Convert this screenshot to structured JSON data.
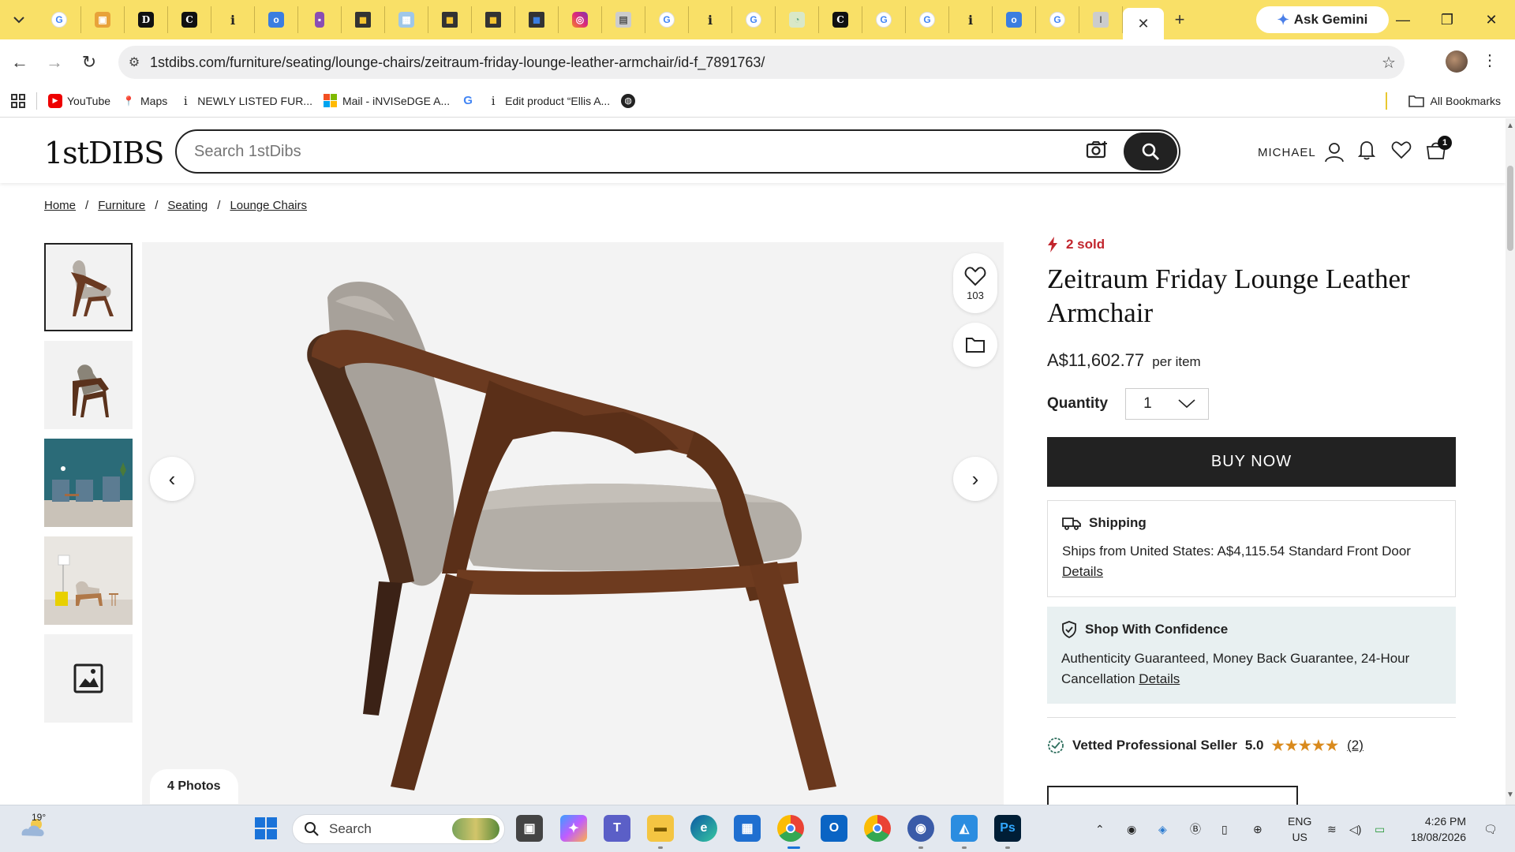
{
  "browser": {
    "active_tab_close": "✕",
    "new_tab": "+",
    "ask_gemini": "Ask Gemini",
    "url": "1stdibs.com/furniture/seating/lounge-chairs/zeitraum-friday-lounge-leather-armchair/id-f_7891763/",
    "bookmarks": [
      {
        "label": "YouTube",
        "icon": "youtube-icon"
      },
      {
        "label": "Maps",
        "icon": "maps-icon"
      },
      {
        "label": "NEWLY LISTED FUR...",
        "icon": "info-icon"
      },
      {
        "label": "Mail - iNVISeDGE A...",
        "icon": "microsoft-icon"
      },
      {
        "label": "",
        "icon": "google-icon"
      },
      {
        "label": "Edit product “Ellis A...",
        "icon": "info-icon"
      },
      {
        "label": "",
        "icon": "globe-icon"
      }
    ],
    "all_bookmarks": "All Bookmarks"
  },
  "site": {
    "logo": "1stDIBS",
    "search_placeholder": "Search 1stDibs",
    "user_name": "MICHAEL",
    "cart_count": "1"
  },
  "breadcrumb": [
    "Home",
    "Furniture",
    "Seating",
    "Lounge Chairs"
  ],
  "gallery": {
    "favorites_count": "103",
    "photos_label": "4 Photos"
  },
  "product": {
    "sold": "2 sold",
    "title": "Zeitraum Friday Lounge Leather Armchair",
    "price": "A$11,602.77",
    "price_unit": "per item",
    "quantity_label": "Quantity",
    "quantity_value": "1",
    "buy_now": "BUY NOW",
    "shipping": {
      "heading": "Shipping",
      "text": "Ships from United States: A$4,115.54 Standard Front Door",
      "link": "Details"
    },
    "confidence": {
      "heading": "Shop With Confidence",
      "text": "Authenticity Guaranteed, Money Back Guarantee, 24-Hour Cancellation",
      "link": "Details"
    },
    "seller": {
      "label": "Vetted Professional Seller",
      "rating": "5.0",
      "stars": "★★★★★",
      "reviews": "(2)"
    }
  },
  "taskbar": {
    "temperature": "19°",
    "search": "Search",
    "lang1": "ENG",
    "lang2": "US",
    "time": "4:26 PM",
    "date": "18/08/2026"
  },
  "colors": {
    "tab_strip": "#f9e067",
    "sold_red": "#c2262e",
    "buy_button": "#222222",
    "confidence_bg": "#e8f0f1",
    "star_gold": "#d98a1d"
  }
}
